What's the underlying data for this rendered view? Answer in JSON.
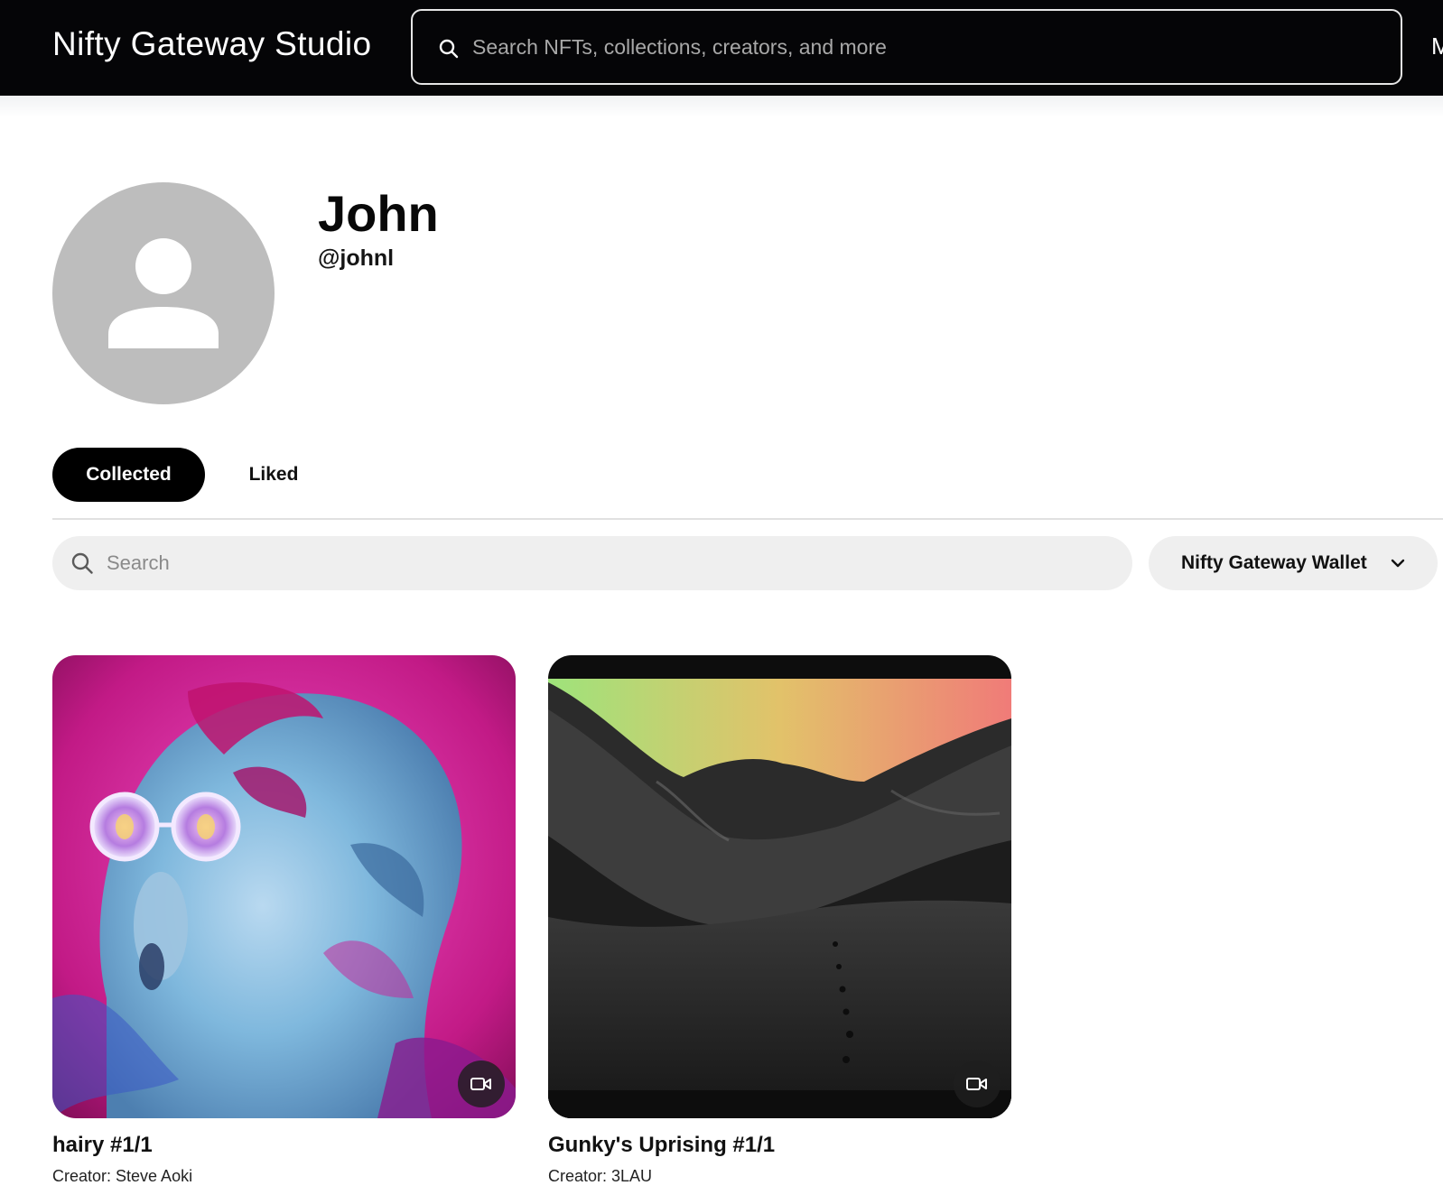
{
  "header": {
    "brand": "Nifty Gateway Studio",
    "search_placeholder": "Search NFTs, collections, creators, and more",
    "cutoff_label": "M"
  },
  "profile": {
    "name": "John",
    "handle": "@johnl"
  },
  "tabs": [
    {
      "label": "Collected",
      "active": true
    },
    {
      "label": "Liked",
      "active": false
    }
  ],
  "filters": {
    "search_placeholder": "Search",
    "wallet_selected": "Nifty Gateway Wallet"
  },
  "items": [
    {
      "title": "hairy #1/1",
      "creator": "Creator: Steve Aoki",
      "media": "video"
    },
    {
      "title": "Gunky's Uprising #1/1",
      "creator": "Creator: 3LAU",
      "media": "video"
    }
  ],
  "icons": {
    "search": "search-icon",
    "chevron": "chevron-down-icon",
    "video": "video-icon",
    "avatar": "user-placeholder-icon"
  },
  "colors": {
    "header_bg": "#050507",
    "active_tab_bg": "#000000",
    "input_bg": "#efefef",
    "avatar_bg": "#bdbdbd"
  }
}
